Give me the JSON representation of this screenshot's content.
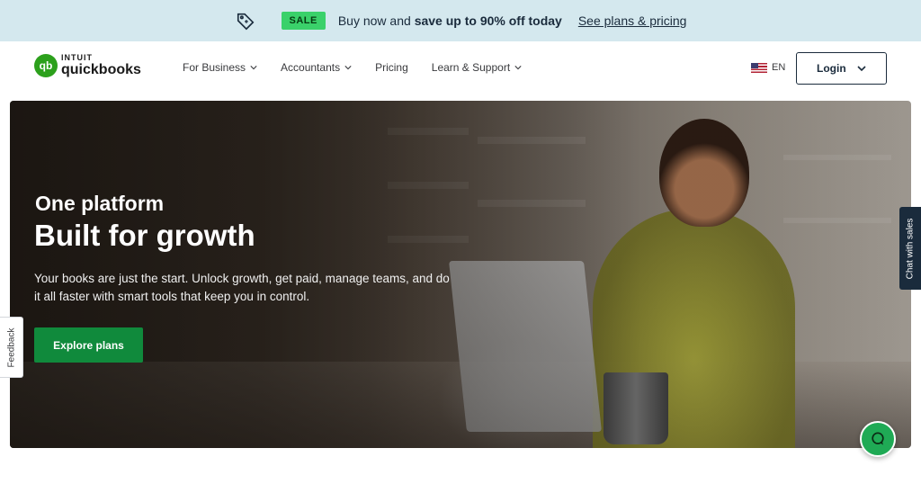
{
  "promo": {
    "tag_icon": "tag-icon",
    "sale_label": "SALE",
    "text_prefix": "Buy now and ",
    "text_bold": "save up to 90% off today",
    "link": "See plans & pricing"
  },
  "header": {
    "logo_top": "INTUIT",
    "logo_bottom": "quickbooks",
    "logo_mark": "qb",
    "nav": [
      {
        "label": "For Business",
        "has_dropdown": true
      },
      {
        "label": "Accountants",
        "has_dropdown": true
      },
      {
        "label": "Pricing",
        "has_dropdown": false
      },
      {
        "label": "Learn & Support",
        "has_dropdown": true
      }
    ],
    "language": "EN",
    "login_label": "Login"
  },
  "hero": {
    "eyebrow": "One platform",
    "title": "Built for growth",
    "description": "Your books are just the start. Unlock growth, get paid, manage teams, and do it all faster with smart tools that keep you in control.",
    "cta_label": "Explore plans"
  },
  "side": {
    "feedback_label": "Feedback",
    "chat_label": "Chat with sales"
  },
  "colors": {
    "brand_green": "#2ca01c",
    "cta_green": "#108a3c",
    "promo_bg": "#d4e8ee",
    "navy": "#1a2b3c"
  }
}
